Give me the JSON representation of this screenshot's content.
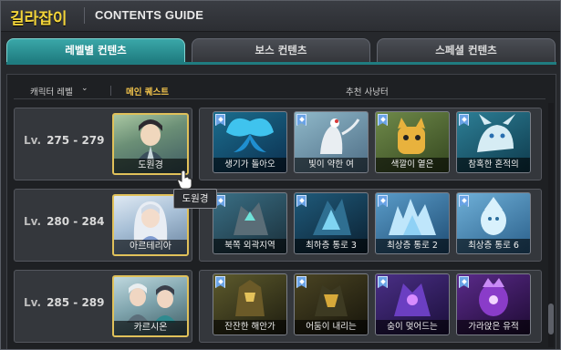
{
  "header": {
    "app_title": "길라잡이",
    "guide_title": "CONTENTS GUIDE"
  },
  "tabs": [
    {
      "label": "레벨별 컨텐츠",
      "active": true
    },
    {
      "label": "보스 컨텐츠",
      "active": false
    },
    {
      "label": "스페셜 컨텐츠",
      "active": false
    }
  ],
  "columns": {
    "level": "캐릭터 레벨",
    "main_quest": "메인 퀘스트",
    "recommended_hunt": "추천 사냥터"
  },
  "rows": [
    {
      "lv_prefix": "Lv.",
      "level_range": "275 - 279",
      "quest": "도원경",
      "monsters": [
        "생기가 돌아오",
        "빛이 약한 여",
        "색깔이 옅은",
        "참혹한 혼적의"
      ]
    },
    {
      "lv_prefix": "Lv.",
      "level_range": "280 - 284",
      "quest": "아르테리아",
      "monsters": [
        "북쪽 외곽지역",
        "최하층 통로 3",
        "최상층 통로 2",
        "최상층 통로 6"
      ]
    },
    {
      "lv_prefix": "Lv.",
      "level_range": "285 - 289",
      "quest": "카르시온",
      "monsters": [
        "잔잔한 해안가",
        "어둠이 내리는",
        "숨이 멎어드는",
        "가라앉은 유적"
      ]
    }
  ],
  "tooltip": "도원경",
  "colors": {
    "accent_title": "#f2d43a",
    "active_tab": "#2f9a9c",
    "main_quest_header": "#f0c24b"
  }
}
